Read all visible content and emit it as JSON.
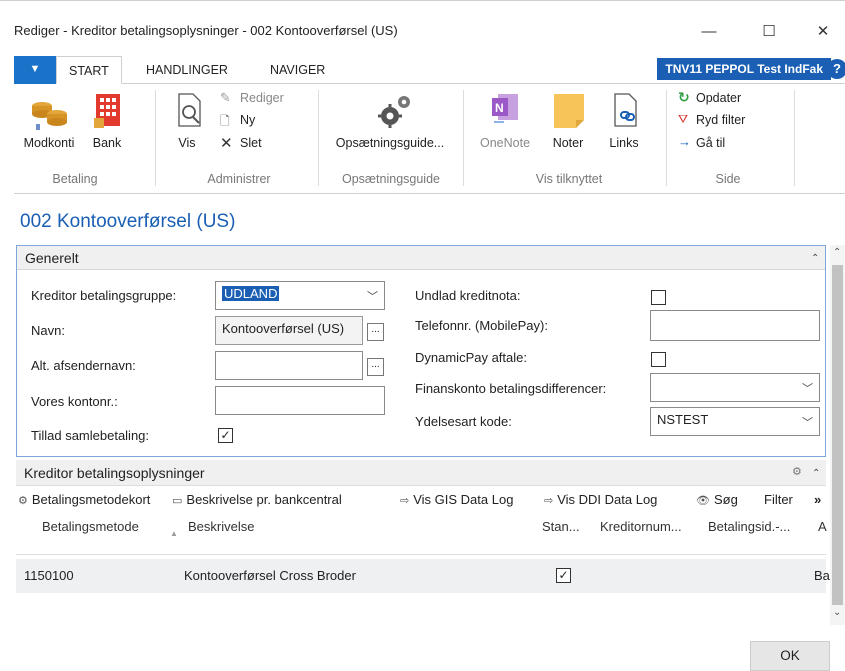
{
  "window": {
    "title": "Rediger - Kreditor betalingsoplysninger - 002 Kontooverførsel (US)",
    "minimize_glyph": "—",
    "maximize_glyph": "☐",
    "close_glyph": "✕"
  },
  "ribbon": {
    "file_glyph": "▼",
    "tabs": [
      "START",
      "HANDLINGER",
      "NAVIGER"
    ],
    "company": "TNV11 PEPPOL Test IndFak",
    "help_glyph": "?",
    "groups": {
      "betaling": {
        "label": "Betaling",
        "buttons": [
          "Modkonti",
          "Bank"
        ]
      },
      "administrer": {
        "label": "Administrer",
        "vis": "Vis",
        "rediger": "Rediger",
        "ny": "Ny",
        "slet": "Slet"
      },
      "opsaetningsguide": {
        "label": "Opsætningsguide",
        "button": "Opsætningsguide..."
      },
      "vis_tilknyttet": {
        "label": "Vis tilknyttet",
        "buttons": [
          "OneNote",
          "Noter",
          "Links"
        ]
      },
      "side": {
        "label": "Side",
        "opdater": "Opdater",
        "ryd_filter": "Ryd filter",
        "gaa_til": "Gå til"
      }
    }
  },
  "page": {
    "title": "002 Kontooverførsel (US)"
  },
  "generelt": {
    "title": "Generelt",
    "left": {
      "betalingsgruppe_label": "Kreditor betalingsgruppe:",
      "betalingsgruppe_value": "UDLAND",
      "navn_label": "Navn:",
      "navn_value": "Kontooverførsel (US)",
      "alt_afsender_label": "Alt. afsendernavn:",
      "alt_afsender_value": "",
      "vores_kontonr_label": "Vores kontonr.:",
      "vores_kontonr_value": "",
      "samlebetaling_label": "Tillad samlebetaling:",
      "samlebetaling_checked": true
    },
    "right": {
      "undlad_kreditnota_label": "Undlad kreditnota:",
      "undlad_kreditnota_checked": false,
      "telefonnr_label": "Telefonnr. (MobilePay):",
      "telefonnr_value": "",
      "dynamicpay_label": "DynamicPay aftale:",
      "dynamicpay_checked": false,
      "finanskonto_label": "Finanskonto betalingsdifferencer:",
      "finanskonto_value": "",
      "ydelsesart_label": "Ydelsesart kode:",
      "ydelsesart_value": "NSTEST"
    }
  },
  "subpage": {
    "title": "Kreditor betalingsoplysninger",
    "toolbar": [
      "Betalingsmetodekort",
      "Beskrivelse pr. bankcentral",
      "Vis GIS Data Log",
      "Vis DDI Data Log",
      "Søg",
      "Filter",
      "»"
    ],
    "columns": [
      "Betalingsmetode",
      "Beskrivelse",
      "Stan...",
      "Kreditornum...",
      "Betalingsid.-...",
      "A"
    ],
    "rows": [
      {
        "betalingsmetode": "1150100",
        "beskrivelse": "Kontooverførsel Cross Broder",
        "standard": true,
        "last": "Ba"
      }
    ]
  },
  "footer": {
    "ok_label": "OK"
  },
  "colors": {
    "accent": "#1a5fb4",
    "file_tab": "#1a73c8",
    "panel_border": "#7fa7d9"
  }
}
